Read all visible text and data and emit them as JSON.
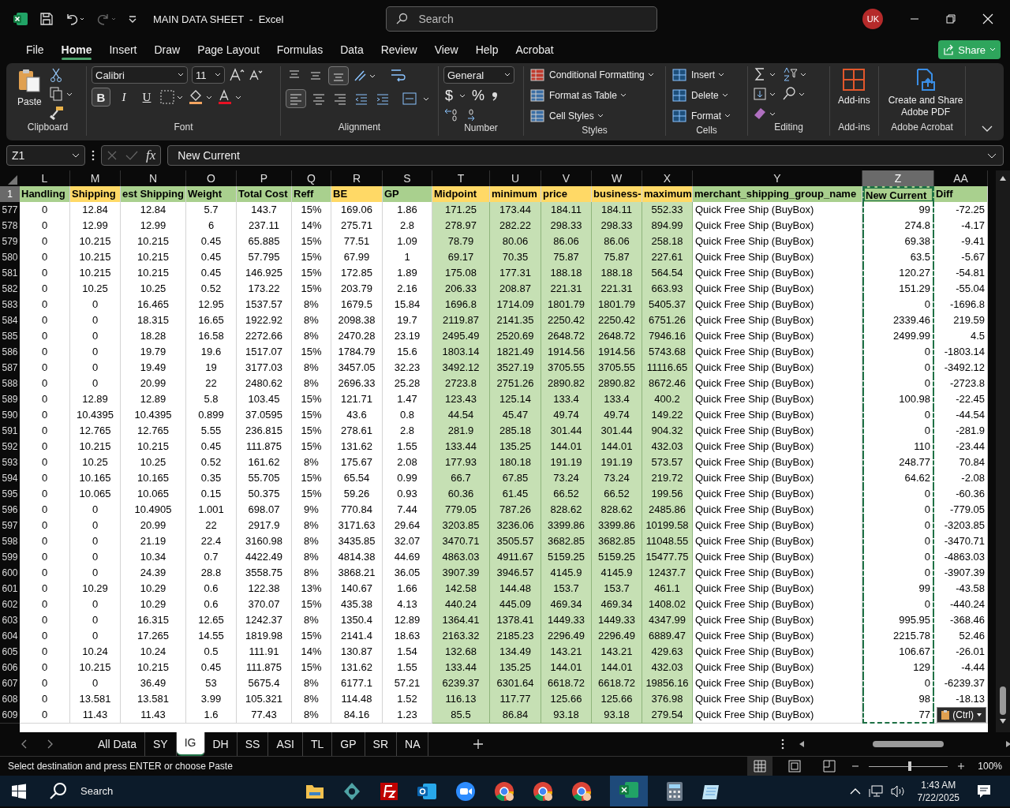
{
  "window": {
    "title": "MAIN DATA SHEET  -  Excel",
    "search_placeholder": "Search",
    "account": "UK"
  },
  "menu_tabs": [
    {
      "label": "File",
      "selected": false
    },
    {
      "label": "Home",
      "selected": true
    },
    {
      "label": "Insert",
      "selected": false
    },
    {
      "label": "Draw",
      "selected": false
    },
    {
      "label": "Page Layout",
      "selected": false
    },
    {
      "label": "Formulas",
      "selected": false
    },
    {
      "label": "Data",
      "selected": false
    },
    {
      "label": "Review",
      "selected": false
    },
    {
      "label": "View",
      "selected": false
    },
    {
      "label": "Help",
      "selected": false
    },
    {
      "label": "Acrobat",
      "selected": false
    }
  ],
  "share": "Share",
  "ribbon": {
    "clipboard": {
      "label": "Clipboard",
      "paste": "Paste"
    },
    "font": {
      "label": "Font",
      "family": "Calibri",
      "size": "11",
      "bold": "B",
      "italic": "I",
      "underline": "U"
    },
    "alignment": {
      "label": "Alignment"
    },
    "number": {
      "label": "Number",
      "format": "General",
      "currency": "$",
      "percent": "%"
    },
    "styles": {
      "label": "Styles",
      "items": [
        "Conditional Formatting",
        "Format as Table",
        "Cell Styles"
      ]
    },
    "cells": {
      "label": "Cells",
      "items": [
        "Insert",
        "Delete",
        "Format"
      ]
    },
    "editing": {
      "label": "Editing"
    },
    "addins": {
      "label": "Add-ins",
      "button": "Add-ins"
    },
    "acrobat": {
      "label": "Adobe Acrobat",
      "button": "Create and Share Adobe PDF"
    }
  },
  "formula_bar": {
    "name_box": "Z1",
    "fx": "fx",
    "content": "New Current"
  },
  "sheet": {
    "header_row": "1",
    "columns": [
      {
        "letter": "L",
        "header": "Handling",
        "color": "#a9d08e",
        "shaded": false,
        "selected": false
      },
      {
        "letter": "M",
        "header": "Shipping",
        "color": "#ffd966",
        "shaded": false,
        "selected": false
      },
      {
        "letter": "N",
        "header": "est Shipping",
        "color": "#a9d08e",
        "shaded": false,
        "selected": false
      },
      {
        "letter": "O",
        "header": "Weight",
        "color": "#a9d08e",
        "shaded": false,
        "selected": false
      },
      {
        "letter": "P",
        "header": "Total Cost",
        "color": "#a9d08e",
        "shaded": false,
        "selected": false
      },
      {
        "letter": "Q",
        "header": "Reff",
        "color": "#a9d08e",
        "shaded": false,
        "selected": false
      },
      {
        "letter": "R",
        "header": "BE",
        "color": "#ffd966",
        "shaded": false,
        "selected": false
      },
      {
        "letter": "S",
        "header": "GP",
        "color": "#a9d08e",
        "shaded": false,
        "selected": false
      },
      {
        "letter": "T",
        "header": "Midpoint",
        "color": "#ffd966",
        "shaded": true,
        "selected": false
      },
      {
        "letter": "U",
        "header": "minimum",
        "color": "#ffd966",
        "shaded": true,
        "selected": false
      },
      {
        "letter": "V",
        "header": "price",
        "color": "#ffd966",
        "shaded": true,
        "selected": false
      },
      {
        "letter": "W",
        "header": "business-",
        "color": "#ffd966",
        "shaded": true,
        "selected": false
      },
      {
        "letter": "X",
        "header": "maximum",
        "color": "#ffd966",
        "shaded": true,
        "selected": false
      },
      {
        "letter": "Y",
        "header": "merchant_shipping_group_name",
        "color": "#a9d08e",
        "shaded": false,
        "selected": false
      },
      {
        "letter": "Z",
        "header": "New Current",
        "color": "#a9d08e",
        "shaded": false,
        "selected": true
      },
      {
        "letter": "AA",
        "header": "Diff",
        "color": "#a9d08e",
        "shaded": false,
        "selected": false
      }
    ],
    "rows": [
      {
        "num": "577",
        "cells": [
          "0",
          "12.84",
          "12.84",
          "5.7",
          "143.7",
          "15%",
          "169.06",
          "1.86",
          "171.25",
          "173.44",
          "184.11",
          "184.11",
          "552.33",
          "Quick Free Ship (BuyBox)",
          "99",
          "-72.25"
        ]
      },
      {
        "num": "578",
        "cells": [
          "0",
          "12.99",
          "12.99",
          "6",
          "237.11",
          "14%",
          "275.71",
          "2.8",
          "278.97",
          "282.22",
          "298.33",
          "298.33",
          "894.99",
          "Quick Free Ship (BuyBox)",
          "274.8",
          "-4.17"
        ]
      },
      {
        "num": "579",
        "cells": [
          "0",
          "10.215",
          "10.215",
          "0.45",
          "65.885",
          "15%",
          "77.51",
          "1.09",
          "78.79",
          "80.06",
          "86.06",
          "86.06",
          "258.18",
          "Quick Free Ship (BuyBox)",
          "69.38",
          "-9.41"
        ]
      },
      {
        "num": "580",
        "cells": [
          "0",
          "10.215",
          "10.215",
          "0.45",
          "57.795",
          "15%",
          "67.99",
          "1",
          "69.17",
          "70.35",
          "75.87",
          "75.87",
          "227.61",
          "Quick Free Ship (BuyBox)",
          "63.5",
          "-5.67"
        ]
      },
      {
        "num": "581",
        "cells": [
          "0",
          "10.215",
          "10.215",
          "0.45",
          "146.925",
          "15%",
          "172.85",
          "1.89",
          "175.08",
          "177.31",
          "188.18",
          "188.18",
          "564.54",
          "Quick Free Ship (BuyBox)",
          "120.27",
          "-54.81"
        ]
      },
      {
        "num": "582",
        "cells": [
          "0",
          "10.25",
          "10.25",
          "0.52",
          "173.22",
          "15%",
          "203.79",
          "2.16",
          "206.33",
          "208.87",
          "221.31",
          "221.31",
          "663.93",
          "Quick Free Ship (BuyBox)",
          "151.29",
          "-55.04"
        ]
      },
      {
        "num": "583",
        "cells": [
          "0",
          "0",
          "16.465",
          "12.95",
          "1537.57",
          "8%",
          "1679.5",
          "15.84",
          "1696.8",
          "1714.09",
          "1801.79",
          "1801.79",
          "5405.37",
          "Quick Free Ship (BuyBox)",
          "0",
          "-1696.8"
        ]
      },
      {
        "num": "584",
        "cells": [
          "0",
          "0",
          "18.315",
          "16.65",
          "1922.92",
          "8%",
          "2098.38",
          "19.7",
          "2119.87",
          "2141.35",
          "2250.42",
          "2250.42",
          "6751.26",
          "Quick Free Ship (BuyBox)",
          "2339.46",
          "219.59"
        ]
      },
      {
        "num": "585",
        "cells": [
          "0",
          "0",
          "18.28",
          "16.58",
          "2272.66",
          "8%",
          "2470.28",
          "23.19",
          "2495.49",
          "2520.69",
          "2648.72",
          "2648.72",
          "7946.16",
          "Quick Free Ship (BuyBox)",
          "2499.99",
          "4.5"
        ]
      },
      {
        "num": "586",
        "cells": [
          "0",
          "0",
          "19.79",
          "19.6",
          "1517.07",
          "15%",
          "1784.79",
          "15.6",
          "1803.14",
          "1821.49",
          "1914.56",
          "1914.56",
          "5743.68",
          "Quick Free Ship (BuyBox)",
          "0",
          "-1803.14"
        ]
      },
      {
        "num": "587",
        "cells": [
          "0",
          "0",
          "19.49",
          "19",
          "3177.03",
          "8%",
          "3457.05",
          "32.23",
          "3492.12",
          "3527.19",
          "3705.55",
          "3705.55",
          "11116.65",
          "Quick Free Ship (BuyBox)",
          "0",
          "-3492.12"
        ]
      },
      {
        "num": "588",
        "cells": [
          "0",
          "0",
          "20.99",
          "22",
          "2480.62",
          "8%",
          "2696.33",
          "25.28",
          "2723.8",
          "2751.26",
          "2890.82",
          "2890.82",
          "8672.46",
          "Quick Free Ship (BuyBox)",
          "0",
          "-2723.8"
        ]
      },
      {
        "num": "589",
        "cells": [
          "0",
          "12.89",
          "12.89",
          "5.8",
          "103.45",
          "15%",
          "121.71",
          "1.47",
          "123.43",
          "125.14",
          "133.4",
          "133.4",
          "400.2",
          "Quick Free Ship (BuyBox)",
          "100.98",
          "-22.45"
        ]
      },
      {
        "num": "590",
        "cells": [
          "0",
          "10.4395",
          "10.4395",
          "0.899",
          "37.0595",
          "15%",
          "43.6",
          "0.8",
          "44.54",
          "45.47",
          "49.74",
          "49.74",
          "149.22",
          "Quick Free Ship (BuyBox)",
          "0",
          "-44.54"
        ]
      },
      {
        "num": "591",
        "cells": [
          "0",
          "12.765",
          "12.765",
          "5.55",
          "236.815",
          "15%",
          "278.61",
          "2.8",
          "281.9",
          "285.18",
          "301.44",
          "301.44",
          "904.32",
          "Quick Free Ship (BuyBox)",
          "0",
          "-281.9"
        ]
      },
      {
        "num": "592",
        "cells": [
          "0",
          "10.215",
          "10.215",
          "0.45",
          "111.875",
          "15%",
          "131.62",
          "1.55",
          "133.44",
          "135.25",
          "144.01",
          "144.01",
          "432.03",
          "Quick Free Ship (BuyBox)",
          "110",
          "-23.44"
        ]
      },
      {
        "num": "593",
        "cells": [
          "0",
          "10.25",
          "10.25",
          "0.52",
          "161.62",
          "8%",
          "175.67",
          "2.08",
          "177.93",
          "180.18",
          "191.19",
          "191.19",
          "573.57",
          "Quick Free Ship (BuyBox)",
          "248.77",
          "70.84"
        ]
      },
      {
        "num": "594",
        "cells": [
          "0",
          "10.165",
          "10.165",
          "0.35",
          "55.705",
          "15%",
          "65.54",
          "0.99",
          "66.7",
          "67.85",
          "73.24",
          "73.24",
          "219.72",
          "Quick Free Ship (BuyBox)",
          "64.62",
          "-2.08"
        ]
      },
      {
        "num": "595",
        "cells": [
          "0",
          "10.065",
          "10.065",
          "0.15",
          "50.375",
          "15%",
          "59.26",
          "0.93",
          "60.36",
          "61.45",
          "66.52",
          "66.52",
          "199.56",
          "Quick Free Ship (BuyBox)",
          "0",
          "-60.36"
        ]
      },
      {
        "num": "596",
        "cells": [
          "0",
          "0",
          "10.4905",
          "1.001",
          "698.07",
          "9%",
          "770.84",
          "7.44",
          "779.05",
          "787.26",
          "828.62",
          "828.62",
          "2485.86",
          "Quick Free Ship (BuyBox)",
          "0",
          "-779.05"
        ]
      },
      {
        "num": "597",
        "cells": [
          "0",
          "0",
          "20.99",
          "22",
          "2917.9",
          "8%",
          "3171.63",
          "29.64",
          "3203.85",
          "3236.06",
          "3399.86",
          "3399.86",
          "10199.58",
          "Quick Free Ship (BuyBox)",
          "0",
          "-3203.85"
        ]
      },
      {
        "num": "598",
        "cells": [
          "0",
          "0",
          "21.19",
          "22.4",
          "3160.98",
          "8%",
          "3435.85",
          "32.07",
          "3470.71",
          "3505.57",
          "3682.85",
          "3682.85",
          "11048.55",
          "Quick Free Ship (BuyBox)",
          "0",
          "-3470.71"
        ]
      },
      {
        "num": "599",
        "cells": [
          "0",
          "0",
          "10.34",
          "0.7",
          "4422.49",
          "8%",
          "4814.38",
          "44.69",
          "4863.03",
          "4911.67",
          "5159.25",
          "5159.25",
          "15477.75",
          "Quick Free Ship (BuyBox)",
          "0",
          "-4863.03"
        ]
      },
      {
        "num": "600",
        "cells": [
          "0",
          "0",
          "24.39",
          "28.8",
          "3558.75",
          "8%",
          "3868.21",
          "36.05",
          "3907.39",
          "3946.57",
          "4145.9",
          "4145.9",
          "12437.7",
          "Quick Free Ship (BuyBox)",
          "0",
          "-3907.39"
        ]
      },
      {
        "num": "601",
        "cells": [
          "0",
          "10.29",
          "10.29",
          "0.6",
          "122.38",
          "13%",
          "140.67",
          "1.66",
          "142.58",
          "144.48",
          "153.7",
          "153.7",
          "461.1",
          "Quick Free Ship (BuyBox)",
          "99",
          "-43.58"
        ]
      },
      {
        "num": "602",
        "cells": [
          "0",
          "0",
          "10.29",
          "0.6",
          "370.07",
          "15%",
          "435.38",
          "4.13",
          "440.24",
          "445.09",
          "469.34",
          "469.34",
          "1408.02",
          "Quick Free Ship (BuyBox)",
          "0",
          "-440.24"
        ]
      },
      {
        "num": "603",
        "cells": [
          "0",
          "0",
          "16.315",
          "12.65",
          "1242.37",
          "8%",
          "1350.4",
          "12.89",
          "1364.41",
          "1378.41",
          "1449.33",
          "1449.33",
          "4347.99",
          "Quick Free Ship (BuyBox)",
          "995.95",
          "-368.46"
        ]
      },
      {
        "num": "604",
        "cells": [
          "0",
          "0",
          "17.265",
          "14.55",
          "1819.98",
          "15%",
          "2141.4",
          "18.63",
          "2163.32",
          "2185.23",
          "2296.49",
          "2296.49",
          "6889.47",
          "Quick Free Ship (BuyBox)",
          "2215.78",
          "52.46"
        ]
      },
      {
        "num": "605",
        "cells": [
          "0",
          "10.24",
          "10.24",
          "0.5",
          "111.91",
          "14%",
          "130.87",
          "1.54",
          "132.68",
          "134.49",
          "143.21",
          "143.21",
          "429.63",
          "Quick Free Ship (BuyBox)",
          "106.67",
          "-26.01"
        ]
      },
      {
        "num": "606",
        "cells": [
          "0",
          "10.215",
          "10.215",
          "0.45",
          "111.875",
          "15%",
          "131.62",
          "1.55",
          "133.44",
          "135.25",
          "144.01",
          "144.01",
          "432.03",
          "Quick Free Ship (BuyBox)",
          "129",
          "-4.44"
        ]
      },
      {
        "num": "607",
        "cells": [
          "0",
          "0",
          "36.49",
          "53",
          "5675.4",
          "8%",
          "6177.1",
          "57.21",
          "6239.37",
          "6301.64",
          "6618.72",
          "6618.72",
          "19856.16",
          "Quick Free Ship (BuyBox)",
          "0",
          "-6239.37"
        ]
      },
      {
        "num": "608",
        "cells": [
          "0",
          "13.581",
          "13.581",
          "3.99",
          "105.321",
          "8%",
          "114.48",
          "1.52",
          "116.13",
          "117.77",
          "125.66",
          "125.66",
          "376.98",
          "Quick Free Ship (BuyBox)",
          "98",
          "-18.13"
        ]
      },
      {
        "num": "609",
        "cells": [
          "0",
          "11.43",
          "11.43",
          "1.6",
          "77.43",
          "8%",
          "84.16",
          "1.23",
          "85.5",
          "86.84",
          "93.18",
          "93.18",
          "279.54",
          "Quick Free Ship (BuyBox)",
          "77"
        ]
      }
    ],
    "paste_options": "(Ctrl)"
  },
  "sheet_tabs": [
    {
      "label": "All Data",
      "selected": false
    },
    {
      "label": "SY",
      "selected": false
    },
    {
      "label": "IG",
      "selected": true
    },
    {
      "label": "DH",
      "selected": false
    },
    {
      "label": "SS",
      "selected": false
    },
    {
      "label": "ASI",
      "selected": false
    },
    {
      "label": "TL",
      "selected": false
    },
    {
      "label": "GP",
      "selected": false
    },
    {
      "label": "SR",
      "selected": false
    },
    {
      "label": "NA",
      "selected": false
    }
  ],
  "status_bar": {
    "message": "Select destination and press ENTER or choose Paste",
    "zoom": "100%",
    "level": 0.5
  },
  "taskbar": {
    "search": "Search",
    "time": "1:43 AM",
    "date": "7/22/2025"
  }
}
